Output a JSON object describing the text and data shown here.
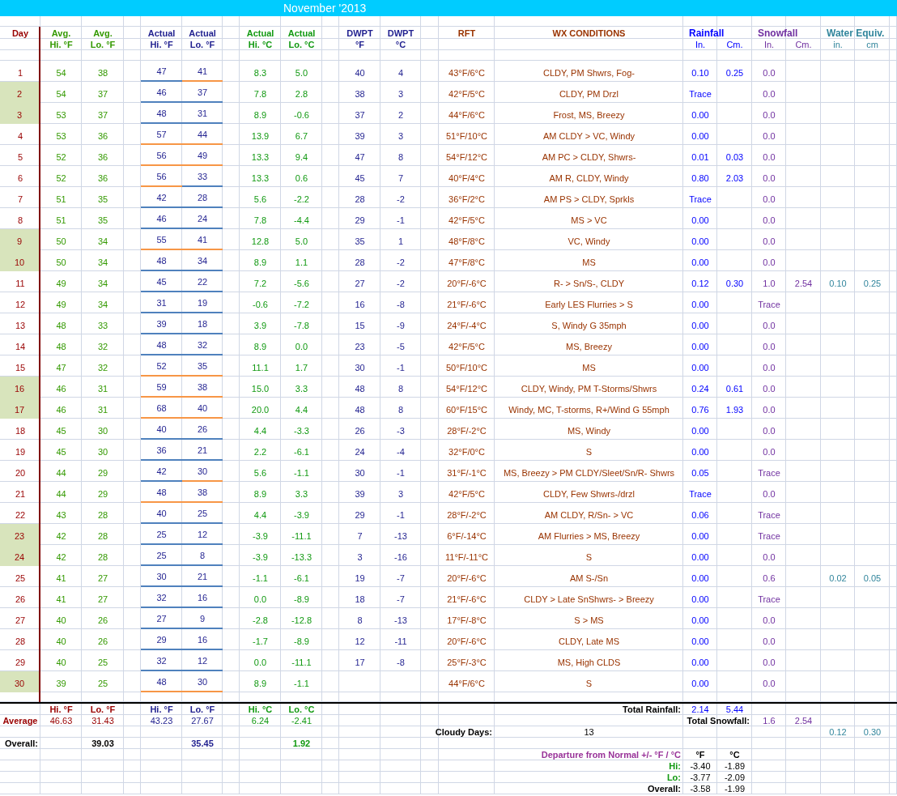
{
  "title": "November '2013",
  "column_headers": [
    {
      "kind": "day",
      "line_1": "Day"
    },
    {
      "kind": "avg",
      "line_1": "Avg.",
      "line_2": "Hi. °F"
    },
    {
      "kind": "avg",
      "line_1": "Avg.",
      "line_2": "Lo. °F"
    },
    {
      "kind": "actual_f",
      "line_1": "Actual",
      "line_2": "Hi. °F"
    },
    {
      "kind": "actual_f",
      "line_1": "Actual",
      "line_2": "Lo. °F"
    },
    {
      "kind": "actual_c",
      "line_1": "Actual",
      "line_2": "Hi. °C"
    },
    {
      "kind": "actual_c",
      "line_1": "Actual",
      "line_2": "Lo. °C"
    },
    {
      "kind": "dwpt",
      "line_1": "DWPT",
      "line_2": "°F"
    },
    {
      "kind": "dwpt",
      "line_1": "DWPT",
      "line_2": "°C"
    },
    {
      "kind": "rft",
      "line_1": "RFT"
    },
    {
      "kind": "wx",
      "line_1": "WX CONDITIONS"
    },
    {
      "kind": "rain",
      "line_1": "Rainfall",
      "line_2": "In."
    },
    {
      "kind": "rain",
      "line_2": "Cm."
    },
    {
      "kind": "snow",
      "line_1": "Snowfall",
      "line_2": "In."
    },
    {
      "kind": "snow",
      "line_2": "Cm."
    },
    {
      "kind": "water",
      "line_1": "Water Equiv.",
      "line_2": "in."
    },
    {
      "kind": "water",
      "line_2": "cm"
    }
  ],
  "days": [
    {
      "day": "1",
      "weekend": false,
      "avg_hi_f": "54",
      "avg_lo_f": "38",
      "actual_hi_f": "47",
      "actual_lo_f": "41",
      "hi_above_avg": false,
      "lo_above_avg": true,
      "actual_hi_c": "8.3",
      "actual_lo_c": "5.0",
      "dewpoint_f": "40",
      "dewpoint_c": "4",
      "rft": "43°F/6°C",
      "conditions": "CLDY, PM Shwrs, Fog-",
      "rain_in": "0.10",
      "rain_cm": "0.25",
      "snow_in": "0.0"
    },
    {
      "day": "2",
      "weekend": true,
      "avg_hi_f": "54",
      "avg_lo_f": "37",
      "actual_hi_f": "46",
      "actual_lo_f": "37",
      "hi_above_avg": false,
      "lo_above_avg": false,
      "actual_hi_c": "7.8",
      "actual_lo_c": "2.8",
      "dewpoint_f": "38",
      "dewpoint_c": "3",
      "rft": "42°F/5°C",
      "conditions": "CLDY, PM Drzl",
      "rain_in": "Trace",
      "snow_in": "0.0"
    },
    {
      "day": "3",
      "weekend": true,
      "avg_hi_f": "53",
      "avg_lo_f": "37",
      "actual_hi_f": "48",
      "actual_lo_f": "31",
      "hi_above_avg": false,
      "lo_above_avg": false,
      "actual_hi_c": "8.9",
      "actual_lo_c": "-0.6",
      "dewpoint_f": "37",
      "dewpoint_c": "2",
      "rft": "44°F/6°C",
      "conditions": "Frost, MS, Breezy",
      "rain_in": "0.00",
      "snow_in": "0.0"
    },
    {
      "day": "4",
      "weekend": false,
      "avg_hi_f": "53",
      "avg_lo_f": "36",
      "actual_hi_f": "57",
      "actual_lo_f": "44",
      "hi_above_avg": true,
      "lo_above_avg": true,
      "actual_hi_c": "13.9",
      "actual_lo_c": "6.7",
      "dewpoint_f": "39",
      "dewpoint_c": "3",
      "rft": "51°F/10°C",
      "conditions": "AM CLDY > VC, Windy",
      "rain_in": "0.00",
      "snow_in": "0.0"
    },
    {
      "day": "5",
      "weekend": false,
      "avg_hi_f": "52",
      "avg_lo_f": "36",
      "actual_hi_f": "56",
      "actual_lo_f": "49",
      "hi_above_avg": true,
      "lo_above_avg": true,
      "actual_hi_c": "13.3",
      "actual_lo_c": "9.4",
      "dewpoint_f": "47",
      "dewpoint_c": "8",
      "rft": "54°F/12°C",
      "conditions": "AM PC > CLDY, Shwrs-",
      "rain_in": "0.01",
      "rain_cm": "0.03",
      "snow_in": "0.0"
    },
    {
      "day": "6",
      "weekend": false,
      "avg_hi_f": "52",
      "avg_lo_f": "36",
      "actual_hi_f": "56",
      "actual_lo_f": "33",
      "hi_above_avg": true,
      "lo_above_avg": false,
      "actual_hi_c": "13.3",
      "actual_lo_c": "0.6",
      "dewpoint_f": "45",
      "dewpoint_c": "7",
      "rft": "40°F/4°C",
      "conditions": "AM R, CLDY, Windy",
      "rain_in": "0.80",
      "rain_cm": "2.03",
      "snow_in": "0.0"
    },
    {
      "day": "7",
      "weekend": false,
      "avg_hi_f": "51",
      "avg_lo_f": "35",
      "actual_hi_f": "42",
      "actual_lo_f": "28",
      "hi_above_avg": false,
      "lo_above_avg": false,
      "actual_hi_c": "5.6",
      "actual_lo_c": "-2.2",
      "dewpoint_f": "28",
      "dewpoint_c": "-2",
      "rft": "36°F/2°C",
      "conditions": "AM PS > CLDY, Sprkls",
      "rain_in": "Trace",
      "snow_in": "0.0"
    },
    {
      "day": "8",
      "weekend": false,
      "avg_hi_f": "51",
      "avg_lo_f": "35",
      "actual_hi_f": "46",
      "actual_lo_f": "24",
      "hi_above_avg": false,
      "lo_above_avg": false,
      "actual_hi_c": "7.8",
      "actual_lo_c": "-4.4",
      "dewpoint_f": "29",
      "dewpoint_c": "-1",
      "rft": "42°F/5°C",
      "conditions": "MS > VC",
      "rain_in": "0.00",
      "snow_in": "0.0"
    },
    {
      "day": "9",
      "weekend": true,
      "avg_hi_f": "50",
      "avg_lo_f": "34",
      "actual_hi_f": "55",
      "actual_lo_f": "41",
      "hi_above_avg": true,
      "lo_above_avg": true,
      "actual_hi_c": "12.8",
      "actual_lo_c": "5.0",
      "dewpoint_f": "35",
      "dewpoint_c": "1",
      "rft": "48°F/8°C",
      "conditions": "VC, Windy",
      "rain_in": "0.00",
      "snow_in": "0.0"
    },
    {
      "day": "10",
      "weekend": true,
      "avg_hi_f": "50",
      "avg_lo_f": "34",
      "actual_hi_f": "48",
      "actual_lo_f": "34",
      "hi_above_avg": false,
      "lo_above_avg": false,
      "actual_hi_c": "8.9",
      "actual_lo_c": "1.1",
      "dewpoint_f": "28",
      "dewpoint_c": "-2",
      "rft": "47°F/8°C",
      "conditions": "MS",
      "rain_in": "0.00",
      "snow_in": "0.0"
    },
    {
      "day": "11",
      "weekend": false,
      "avg_hi_f": "49",
      "avg_lo_f": "34",
      "actual_hi_f": "45",
      "actual_lo_f": "22",
      "hi_above_avg": false,
      "lo_above_avg": false,
      "actual_hi_c": "7.2",
      "actual_lo_c": "-5.6",
      "dewpoint_f": "27",
      "dewpoint_c": "-2",
      "rft": "20°F/-6°C",
      "conditions": "R- > Sn/S-, CLDY",
      "rain_in": "0.12",
      "rain_cm": "0.30",
      "snow_in": "1.0",
      "snow_cm": "2.54",
      "water_in": "0.10",
      "water_cm": "0.25"
    },
    {
      "day": "12",
      "weekend": false,
      "avg_hi_f": "49",
      "avg_lo_f": "34",
      "actual_hi_f": "31",
      "actual_lo_f": "19",
      "hi_above_avg": false,
      "lo_above_avg": false,
      "actual_hi_c": "-0.6",
      "actual_lo_c": "-7.2",
      "dewpoint_f": "16",
      "dewpoint_c": "-8",
      "rft": "21°F/-6°C",
      "conditions": "Early LES Flurries > S",
      "rain_in": "0.00",
      "snow_in": "Trace"
    },
    {
      "day": "13",
      "weekend": false,
      "avg_hi_f": "48",
      "avg_lo_f": "33",
      "actual_hi_f": "39",
      "actual_lo_f": "18",
      "hi_above_avg": false,
      "lo_above_avg": false,
      "actual_hi_c": "3.9",
      "actual_lo_c": "-7.8",
      "dewpoint_f": "15",
      "dewpoint_c": "-9",
      "rft": "24°F/-4°C",
      "conditions": "S, Windy G 35mph",
      "rain_in": "0.00",
      "snow_in": "0.0"
    },
    {
      "day": "14",
      "weekend": false,
      "avg_hi_f": "48",
      "avg_lo_f": "32",
      "actual_hi_f": "48",
      "actual_lo_f": "32",
      "hi_above_avg": false,
      "lo_above_avg": false,
      "actual_hi_c": "8.9",
      "actual_lo_c": "0.0",
      "dewpoint_f": "23",
      "dewpoint_c": "-5",
      "rft": "42°F/5°C",
      "conditions": "MS, Breezy",
      "rain_in": "0.00",
      "snow_in": "0.0"
    },
    {
      "day": "15",
      "weekend": false,
      "avg_hi_f": "47",
      "avg_lo_f": "32",
      "actual_hi_f": "52",
      "actual_lo_f": "35",
      "hi_above_avg": true,
      "lo_above_avg": true,
      "actual_hi_c": "11.1",
      "actual_lo_c": "1.7",
      "dewpoint_f": "30",
      "dewpoint_c": "-1",
      "rft": "50°F/10°C",
      "conditions": "MS",
      "rain_in": "0.00",
      "snow_in": "0.0"
    },
    {
      "day": "16",
      "weekend": true,
      "avg_hi_f": "46",
      "avg_lo_f": "31",
      "actual_hi_f": "59",
      "actual_lo_f": "38",
      "hi_above_avg": true,
      "lo_above_avg": true,
      "actual_hi_c": "15.0",
      "actual_lo_c": "3.3",
      "dewpoint_f": "48",
      "dewpoint_c": "8",
      "rft": "54°F/12°C",
      "conditions": "CLDY, Windy, PM T-Storms/Shwrs",
      "rain_in": "0.24",
      "rain_cm": "0.61",
      "snow_in": "0.0"
    },
    {
      "day": "17",
      "weekend": true,
      "avg_hi_f": "46",
      "avg_lo_f": "31",
      "actual_hi_f": "68",
      "actual_lo_f": "40",
      "hi_above_avg": true,
      "lo_above_avg": true,
      "actual_hi_c": "20.0",
      "actual_lo_c": "4.4",
      "dewpoint_f": "48",
      "dewpoint_c": "8",
      "rft": "60°F/15°C",
      "conditions": "Windy, MC, T-storms, R+/Wind G 55mph",
      "rain_in": "0.76",
      "rain_cm": "1.93",
      "snow_in": "0.0"
    },
    {
      "day": "18",
      "weekend": false,
      "avg_hi_f": "45",
      "avg_lo_f": "30",
      "actual_hi_f": "40",
      "actual_lo_f": "26",
      "hi_above_avg": false,
      "lo_above_avg": false,
      "actual_hi_c": "4.4",
      "actual_lo_c": "-3.3",
      "dewpoint_f": "26",
      "dewpoint_c": "-3",
      "rft": "28°F/-2°C",
      "conditions": "MS, Windy",
      "rain_in": "0.00",
      "snow_in": "0.0"
    },
    {
      "day": "19",
      "weekend": false,
      "avg_hi_f": "45",
      "avg_lo_f": "30",
      "actual_hi_f": "36",
      "actual_lo_f": "21",
      "hi_above_avg": false,
      "lo_above_avg": false,
      "actual_hi_c": "2.2",
      "actual_lo_c": "-6.1",
      "dewpoint_f": "24",
      "dewpoint_c": "-4",
      "rft": "32°F/0°C",
      "conditions": "S",
      "rain_in": "0.00",
      "snow_in": "0.0"
    },
    {
      "day": "20",
      "weekend": false,
      "avg_hi_f": "44",
      "avg_lo_f": "29",
      "actual_hi_f": "42",
      "actual_lo_f": "30",
      "hi_above_avg": false,
      "lo_above_avg": true,
      "actual_hi_c": "5.6",
      "actual_lo_c": "-1.1",
      "dewpoint_f": "30",
      "dewpoint_c": "-1",
      "rft": "31°F/-1°C",
      "conditions": "MS, Breezy > PM CLDY/Sleet/Sn/R- Shwrs",
      "rain_in": "0.05",
      "snow_in": "Trace"
    },
    {
      "day": "21",
      "weekend": false,
      "avg_hi_f": "44",
      "avg_lo_f": "29",
      "actual_hi_f": "48",
      "actual_lo_f": "38",
      "hi_above_avg": true,
      "lo_above_avg": true,
      "actual_hi_c": "8.9",
      "actual_lo_c": "3.3",
      "dewpoint_f": "39",
      "dewpoint_c": "3",
      "rft": "42°F/5°C",
      "conditions": "CLDY, Few Shwrs-/drzl",
      "rain_in": "Trace",
      "snow_in": "0.0"
    },
    {
      "day": "22",
      "weekend": false,
      "avg_hi_f": "43",
      "avg_lo_f": "28",
      "actual_hi_f": "40",
      "actual_lo_f": "25",
      "hi_above_avg": false,
      "lo_above_avg": false,
      "actual_hi_c": "4.4",
      "actual_lo_c": "-3.9",
      "dewpoint_f": "29",
      "dewpoint_c": "-1",
      "rft": "28°F/-2°C",
      "conditions": "AM CLDY, R/Sn- > VC",
      "rain_in": "0.06",
      "snow_in": "Trace"
    },
    {
      "day": "23",
      "weekend": true,
      "avg_hi_f": "42",
      "avg_lo_f": "28",
      "actual_hi_f": "25",
      "actual_lo_f": "12",
      "hi_above_avg": false,
      "lo_above_avg": false,
      "actual_hi_c": "-3.9",
      "actual_lo_c": "-11.1",
      "dewpoint_f": "7",
      "dewpoint_c": "-13",
      "rft": "6°F/-14°C",
      "conditions": "AM Flurries > MS, Breezy",
      "rain_in": "0.00",
      "snow_in": "Trace"
    },
    {
      "day": "24",
      "weekend": true,
      "avg_hi_f": "42",
      "avg_lo_f": "28",
      "actual_hi_f": "25",
      "actual_lo_f": "8",
      "hi_above_avg": false,
      "lo_above_avg": false,
      "actual_hi_c": "-3.9",
      "actual_lo_c": "-13.3",
      "dewpoint_f": "3",
      "dewpoint_c": "-16",
      "rft": "11°F/-11°C",
      "conditions": "S",
      "rain_in": "0.00",
      "snow_in": "0.0"
    },
    {
      "day": "25",
      "weekend": false,
      "avg_hi_f": "41",
      "avg_lo_f": "27",
      "actual_hi_f": "30",
      "actual_lo_f": "21",
      "hi_above_avg": false,
      "lo_above_avg": false,
      "actual_hi_c": "-1.1",
      "actual_lo_c": "-6.1",
      "dewpoint_f": "19",
      "dewpoint_c": "-7",
      "rft": "20°F/-6°C",
      "conditions": "AM S-/Sn",
      "rain_in": "0.00",
      "snow_in": "0.6",
      "water_in": "0.02",
      "water_cm": "0.05"
    },
    {
      "day": "26",
      "weekend": false,
      "avg_hi_f": "41",
      "avg_lo_f": "27",
      "actual_hi_f": "32",
      "actual_lo_f": "16",
      "hi_above_avg": false,
      "lo_above_avg": false,
      "actual_hi_c": "0.0",
      "actual_lo_c": "-8.9",
      "dewpoint_f": "18",
      "dewpoint_c": "-7",
      "rft": "21°F/-6°C",
      "conditions": "CLDY > Late SnShwrs- > Breezy",
      "rain_in": "0.00",
      "snow_in": "Trace"
    },
    {
      "day": "27",
      "weekend": false,
      "avg_hi_f": "40",
      "avg_lo_f": "26",
      "actual_hi_f": "27",
      "actual_lo_f": "9",
      "hi_above_avg": false,
      "lo_above_avg": false,
      "actual_hi_c": "-2.8",
      "actual_lo_c": "-12.8",
      "dewpoint_f": "8",
      "dewpoint_c": "-13",
      "rft": "17°F/-8°C",
      "conditions": "S > MS",
      "rain_in": "0.00",
      "snow_in": "0.0"
    },
    {
      "day": "28",
      "weekend": false,
      "avg_hi_f": "40",
      "avg_lo_f": "26",
      "actual_hi_f": "29",
      "actual_lo_f": "16",
      "hi_above_avg": false,
      "lo_above_avg": false,
      "actual_hi_c": "-1.7",
      "actual_lo_c": "-8.9",
      "dewpoint_f": "12",
      "dewpoint_c": "-11",
      "rft": "20°F/-6°C",
      "conditions": "CLDY, Late MS",
      "rain_in": "0.00",
      "snow_in": "0.0"
    },
    {
      "day": "29",
      "weekend": false,
      "avg_hi_f": "40",
      "avg_lo_f": "25",
      "actual_hi_f": "32",
      "actual_lo_f": "12",
      "hi_above_avg": false,
      "lo_above_avg": false,
      "actual_hi_c": "0.0",
      "actual_lo_c": "-11.1",
      "dewpoint_f": "17",
      "dewpoint_c": "-8",
      "rft": "25°F/-3°C",
      "conditions": "MS, High CLDS",
      "rain_in": "0.00",
      "snow_in": "0.0"
    },
    {
      "day": "30",
      "weekend": true,
      "avg_hi_f": "39",
      "avg_lo_f": "25",
      "actual_hi_f": "48",
      "actual_lo_f": "30",
      "hi_above_avg": true,
      "lo_above_avg": true,
      "actual_hi_c": "8.9",
      "actual_lo_c": "-1.1",
      "rft": "44°F/6°C",
      "conditions": "S",
      "rain_in": "0.00",
      "snow_in": "0.0"
    }
  ],
  "averages": {
    "label": "Average",
    "cells": [
      {
        "kind": "avg",
        "header": "Hi. °F",
        "value": "46.63"
      },
      {
        "kind": "avg",
        "header": "Lo. °F",
        "value": "31.43"
      },
      {
        "kind": "actual_f",
        "header": "Hi. °F",
        "value": "43.23"
      },
      {
        "kind": "actual_f",
        "header": "Lo. °F",
        "value": "27.67"
      },
      {
        "kind": "actual_c",
        "header": "Hi. °C",
        "value": "6.24"
      },
      {
        "kind": "actual_c",
        "header": "Lo. °C",
        "value": "-2.41"
      }
    ]
  },
  "overall": {
    "label": "Overall:",
    "values": [
      {
        "kind": "avg",
        "value": "39.03"
      },
      {
        "kind": "actual_f",
        "value": "35.45"
      },
      {
        "kind": "actual_c",
        "value": "1.92"
      }
    ]
  },
  "total_rainfall": {
    "label": "Total Rainfall:",
    "in": "2.14",
    "cm": "5.44"
  },
  "total_snowfall": {
    "label": "Total Snowfall:",
    "in": "1.6",
    "cm": "2.54"
  },
  "cloudy_days": {
    "label": "Cloudy Days:",
    "value": "13"
  },
  "total_water_equiv": {
    "in": "0.12",
    "cm": "0.30"
  },
  "departure": {
    "title": "Departure from Normal +/- °F / °C",
    "unit_f": "°F",
    "unit_c": "°C",
    "rows": [
      {
        "kind": "hi",
        "label": "Hi:",
        "f": "-3.40",
        "c": "-1.89"
      },
      {
        "kind": "lo",
        "label": "Lo:",
        "f": "-3.77",
        "c": "-2.09"
      },
      {
        "kind": "overall",
        "label": "Overall:",
        "f": "-3.58",
        "c": "-1.99"
      }
    ]
  }
}
